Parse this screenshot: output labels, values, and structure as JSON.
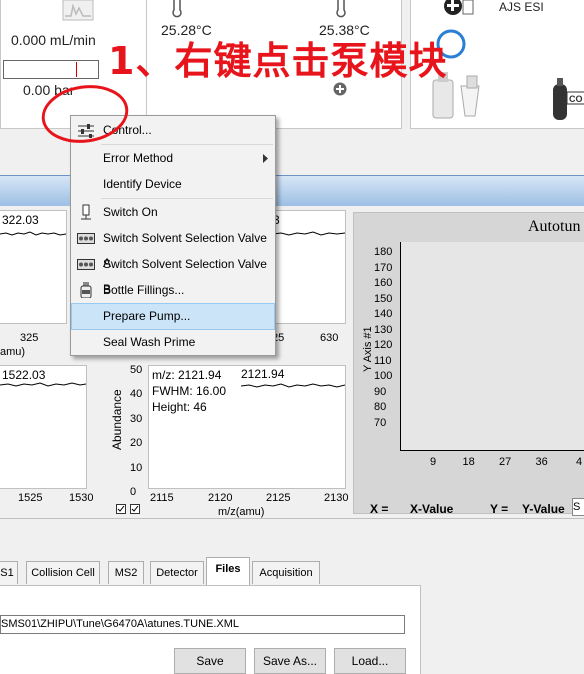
{
  "annotation": {
    "text": "1、右键点击泵模块",
    "color": "#e8141b"
  },
  "pump_module": {
    "flow": "0.000 mL/min",
    "pressure": "0.00 bar",
    "pressure_fraction": 0.78
  },
  "temperatures": {
    "left": "25.28°C",
    "right": "25.38°C"
  },
  "source": {
    "label": "AJS ESI",
    "badge": "CO"
  },
  "context_menu": {
    "items": [
      {
        "label": "Control...",
        "icon": "sliders-icon"
      },
      {
        "label": "Error Method",
        "icon": "",
        "submenu": true
      },
      {
        "label": "Identify Device",
        "icon": ""
      },
      {
        "label": "Switch On",
        "icon": "power-switch-icon"
      },
      {
        "label": "Switch Solvent Selection Valve A",
        "icon": "valve-icon"
      },
      {
        "label": "Switch Solvent Selection Valve B",
        "icon": "valve-icon"
      },
      {
        "label": "Bottle Fillings...",
        "icon": "bottle-icon"
      },
      {
        "label": "Prepare Pump...",
        "icon": ""
      },
      {
        "label": "Seal Wash Prime",
        "icon": ""
      }
    ],
    "highlighted": "Prepare Pump..."
  },
  "plot_top_left": {
    "peak": "322.03",
    "tick": "325",
    "xunit": "amu)"
  },
  "plot_top_mid": {
    "peak": "3",
    "ticks": [
      "25",
      "630"
    ]
  },
  "plot_bottom_left": {
    "peak": "1522.03",
    "ticks": [
      "1525",
      "1530"
    ]
  },
  "plot_bottom_mid": {
    "ylabel": "Abundance",
    "yticks": [
      "50",
      "40",
      "30",
      "20",
      "10",
      "0"
    ],
    "info_mz": "m/z: 2121.94",
    "peak": "2121.94",
    "fwhm": "FWHM: 16.00",
    "height": "Height: 46",
    "xticks": [
      "2115",
      "2120",
      "2125",
      "2130"
    ],
    "xlabel": "m/z(amu)"
  },
  "autotune": {
    "title": "Autotun",
    "ylabel": "Y Axis #1",
    "yticks": [
      "180",
      "170",
      "160",
      "150",
      "140",
      "130",
      "120",
      "110",
      "100",
      "90",
      "80",
      "70"
    ],
    "xticks": [
      "9",
      "18",
      "27",
      "36",
      "4"
    ],
    "x_label": "X =",
    "x_value": "X-Value",
    "y_label": "Y =",
    "y_value": "Y-Value",
    "s_box": "S"
  },
  "tabs": {
    "items": [
      "S1",
      "Collision Cell",
      "MS2",
      "Detector",
      "Files",
      "Acquisition"
    ],
    "active": "Files"
  },
  "files": {
    "path": "SMS01\\ZHIPU\\Tune\\G6470A\\atunes.TUNE.XML",
    "save": "Save",
    "save_as": "Save As...",
    "load": "Load..."
  }
}
